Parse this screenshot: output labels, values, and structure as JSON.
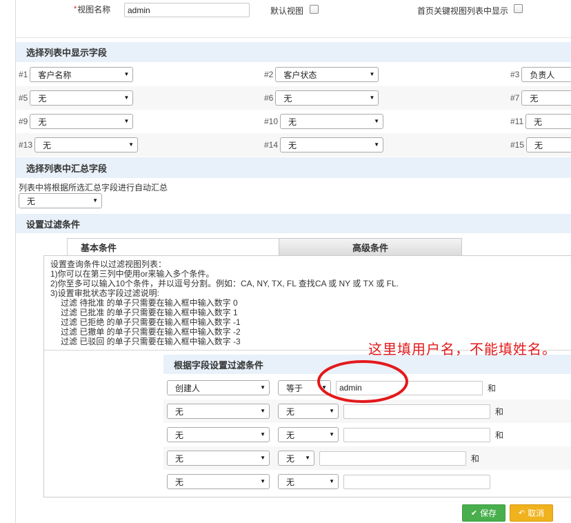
{
  "view_form": {
    "required_mark": "*",
    "view_name_label": "视图名称",
    "view_name_value": "admin",
    "default_view_label": "默认视图",
    "default_view_checked": false,
    "home_display_label": "首页关键视图列表中显示",
    "home_display_checked": false
  },
  "display_fields": {
    "header": "选择列表中显示字段",
    "rows": [
      [
        {
          "num": "#1",
          "value": "客户名称"
        },
        {
          "num": "#2",
          "value": "客户状态"
        },
        {
          "num": "#3",
          "value": "负责人"
        }
      ],
      [
        {
          "num": "#5",
          "value": "无"
        },
        {
          "num": "#6",
          "value": "无"
        },
        {
          "num": "#7",
          "value": "无"
        }
      ],
      [
        {
          "num": "#9",
          "value": "无"
        },
        {
          "num": "#10",
          "value": "无"
        },
        {
          "num": "#11",
          "value": "无"
        }
      ],
      [
        {
          "num": "#13",
          "value": "无"
        },
        {
          "num": "#14",
          "value": "无"
        },
        {
          "num": "#15",
          "value": "无"
        }
      ]
    ]
  },
  "summary_fields": {
    "header": "选择列表中汇总字段",
    "description": "列表中将根据所选汇总字段进行自动汇总",
    "value": "无"
  },
  "filter": {
    "header": "设置过滤条件",
    "tabs": [
      "基本条件",
      "高级条件"
    ],
    "instructions": [
      "设置查询条件以过滤视图列表：",
      "1)你可以在第三列中使用or来输入多个条件。",
      "2)你至多可以输入10个条件，并以逗号分割。例如：CA, NY, TX, FL 查找CA 或 NY 或 TX 或 FL.",
      "3)设置审批状态字段过滤说明:",
      "过滤 待批准 的单子只需要在输入框中输入数字 0",
      "过滤 已批准 的单子只需要在输入框中输入数字 1",
      "过滤 已拒绝 的单子只需要在输入框中输入数字 -1",
      "过滤 已撤单 的单子只需要在输入框中输入数字 -2",
      "过滤 已驳回 的单子只需要在输入框中输入数字 -3"
    ],
    "annotation": "这里填用户名，不能填姓名。",
    "conditions_header": "根据字段设置过滤条件",
    "conditions": [
      {
        "field": "创建人",
        "operator": "等于",
        "value": "admin",
        "join": "和"
      },
      {
        "field": "无",
        "operator": "无",
        "value": "",
        "join": "和"
      },
      {
        "field": "无",
        "operator": "无",
        "value": "",
        "join": "和"
      },
      {
        "field": "无",
        "operator": "无",
        "value": "",
        "join": "和"
      },
      {
        "field": "无",
        "operator": "无",
        "value": ""
      }
    ]
  },
  "actions": {
    "save_label": "保存",
    "save_icon": "check-icon",
    "cancel_label": "取消",
    "cancel_icon": "undo-icon"
  },
  "colors": {
    "section_header_bg": "#e8f0f9",
    "required_mark": "#e0201a",
    "annotation": "#e3191b",
    "save_button": "#49ae4c",
    "cancel_button": "#f0b21d"
  }
}
